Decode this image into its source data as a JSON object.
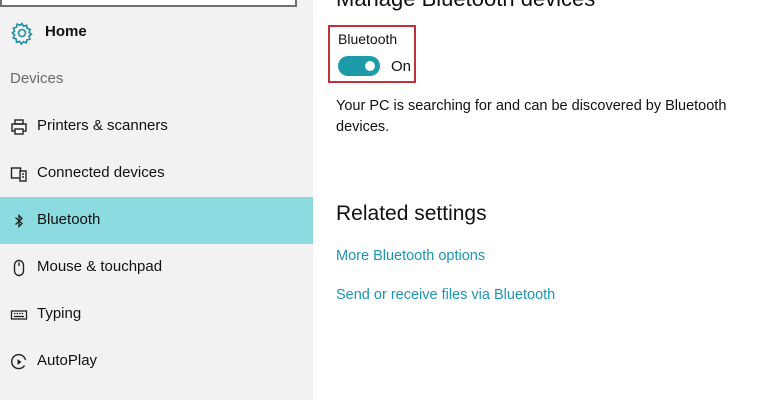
{
  "sidebar": {
    "home_label": "Home",
    "section_title": "Devices",
    "items": [
      {
        "label": "Printers & scanners",
        "icon": "printer-icon"
      },
      {
        "label": "Connected devices",
        "icon": "connected-devices-icon"
      },
      {
        "label": "Bluetooth",
        "icon": "bluetooth-icon",
        "selected": true
      },
      {
        "label": "Mouse & touchpad",
        "icon": "mouse-icon"
      },
      {
        "label": "Typing",
        "icon": "keyboard-icon"
      },
      {
        "label": "AutoPlay",
        "icon": "autoplay-icon"
      }
    ]
  },
  "main": {
    "page_title": "Manage Bluetooth devices",
    "bluetooth": {
      "label": "Bluetooth",
      "state": "On",
      "enabled": true
    },
    "status_text": "Your PC is searching for and can be discovered by Bluetooth devices.",
    "related_title": "Related settings",
    "links": [
      "More Bluetooth options",
      "Send or receive files via Bluetooth"
    ]
  },
  "colors": {
    "accent": "#1e9ba8",
    "selected_bg": "#8cdbe0",
    "link": "#1b96b5",
    "highlight_border": "#c2323b",
    "sidebar_bg": "#f2f2f2"
  }
}
